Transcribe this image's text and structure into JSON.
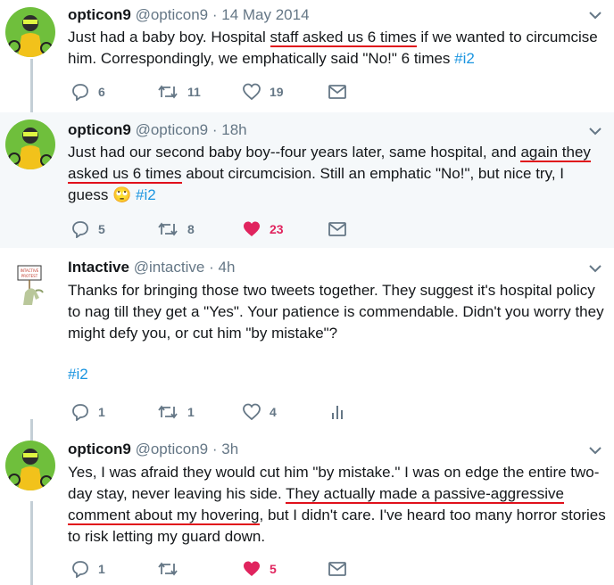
{
  "tweets": [
    {
      "name": "opticon9",
      "handle": "@opticon9",
      "time": "14 May 2014",
      "text_parts": [
        "Just had a baby boy. Hospital ",
        "staff asked us 6 times",
        " if we wanted to circumcise him. Correspondingly, we emphatically said \"No!\" 6 times ",
        "#i2"
      ],
      "replies": "6",
      "retweets": "11",
      "likes": "19"
    },
    {
      "name": "opticon9",
      "handle": "@opticon9",
      "time": "18h",
      "text_parts": [
        "Just had our second baby boy--four years later, same hospital, and ",
        "again they",
        " ",
        "asked us 6 times",
        " about circumcision. Still an emphatic \"No!\", but nice try, I guess ",
        "🙄",
        " ",
        "#i2"
      ],
      "replies": "5",
      "retweets": "8",
      "likes": "23"
    },
    {
      "name": "Intactive",
      "handle": "@intactive",
      "time": "4h",
      "text_parts": [
        "Thanks for bringing those two tweets together. They suggest it's hospital policy to nag till they get a \"Yes\". Your patience is commendable. Didn't you worry they might defy you, or cut him \"by mistake\"?",
        "#i2"
      ],
      "avatar_sign": "INTACTIVE PROTEST",
      "replies": "1",
      "retweets": "1",
      "likes": "4"
    },
    {
      "name": "opticon9",
      "handle": "@opticon9",
      "time": "3h",
      "text_parts": [
        "Yes, I was afraid they would cut him \"by mistake.\" I was on edge the entire two-day stay, never leaving his side. ",
        "They actually made a passive-aggressive comment about my hovering",
        ", but I didn't care. I've heard too many horror stories to risk letting my guard down."
      ],
      "replies": "1",
      "retweets": "",
      "likes": "5"
    }
  ],
  "colors": {
    "text": "#14171a",
    "secondary": "#657786",
    "link": "#1b95e0",
    "like": "#e0245e",
    "underline": "#e0101b",
    "highlight_bg": "#f5f8fa"
  },
  "separator": "·"
}
